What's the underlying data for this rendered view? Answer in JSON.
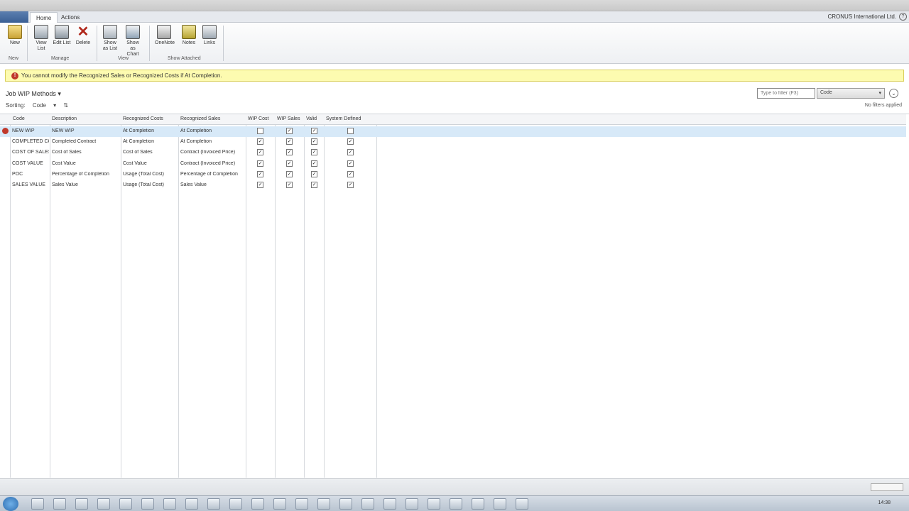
{
  "app": {
    "window_title": "",
    "company": "CRONUS International Ltd."
  },
  "ribbon_tabs": [
    "Home",
    "Actions"
  ],
  "ribbon": {
    "groups": [
      {
        "label": "New",
        "buttons": [
          {
            "label": "New",
            "icon": "new-icon"
          }
        ]
      },
      {
        "label": "Manage",
        "buttons": [
          {
            "label": "View List",
            "icon": "view-list-icon"
          },
          {
            "label": "Edit List",
            "icon": "edit-list-icon"
          },
          {
            "label": "Delete",
            "icon": "delete-icon"
          }
        ]
      },
      {
        "label": "View",
        "buttons": [
          {
            "label": "Show as List",
            "icon": "show-list-icon"
          },
          {
            "label": "Show as Chart",
            "icon": "show-chart-icon"
          }
        ]
      },
      {
        "label": "Show Attached",
        "buttons": [
          {
            "label": "OneNote",
            "icon": "onenote-icon"
          },
          {
            "label": "Notes",
            "icon": "notes-icon"
          },
          {
            "label": "Links",
            "icon": "links-icon"
          }
        ]
      }
    ]
  },
  "infobar": {
    "message": "You cannot modify the Recognized Sales or Recognized Costs if At Completion."
  },
  "page": {
    "title": "Job WIP Methods",
    "sorting_label": "Sorting:",
    "sort_field": "Code",
    "filter_placeholder": "Type to filter (F3)",
    "filter_field": "Code",
    "filter_status": "No filters applied"
  },
  "grid": {
    "columns": [
      "Code",
      "Description",
      "Recognized Costs",
      "Recognized Sales",
      "WIP Cost",
      "WIP Sales",
      "Valid",
      "System Defined"
    ],
    "rows": [
      {
        "code": "NEW WIP",
        "description": "NEW WIP",
        "rec_costs": "At Completion",
        "rec_sales": "At Completion",
        "wip_cost": false,
        "wip_sales": true,
        "valid": true,
        "system_defined": false,
        "selected": true
      },
      {
        "code": "COMPLETED CONTRACT",
        "description": "Completed Contract",
        "rec_costs": "At Completion",
        "rec_sales": "At Completion",
        "wip_cost": true,
        "wip_sales": true,
        "valid": true,
        "system_defined": true,
        "selected": false
      },
      {
        "code": "COST OF SALES",
        "description": "Cost of Sales",
        "rec_costs": "Cost of Sales",
        "rec_sales": "Contract (Invoiced Price)",
        "wip_cost": true,
        "wip_sales": true,
        "valid": true,
        "system_defined": true,
        "selected": false
      },
      {
        "code": "COST VALUE",
        "description": "Cost Value",
        "rec_costs": "Cost Value",
        "rec_sales": "Contract (Invoiced Price)",
        "wip_cost": true,
        "wip_sales": true,
        "valid": true,
        "system_defined": true,
        "selected": false
      },
      {
        "code": "POC",
        "description": "Percentage of Completion",
        "rec_costs": "Usage (Total Cost)",
        "rec_sales": "Percentage of Completion",
        "wip_cost": true,
        "wip_sales": true,
        "valid": true,
        "system_defined": true,
        "selected": false
      },
      {
        "code": "SALES VALUE",
        "description": "Sales Value",
        "rec_costs": "Usage (Total Cost)",
        "rec_sales": "Sales Value",
        "wip_cost": true,
        "wip_sales": true,
        "valid": true,
        "system_defined": true,
        "selected": false
      }
    ]
  },
  "taskbar": {
    "clock": "14:38"
  },
  "colors": {
    "selection": "#d7e9f8",
    "infobar": "#fdfbb0",
    "warning": "#c0392b"
  }
}
